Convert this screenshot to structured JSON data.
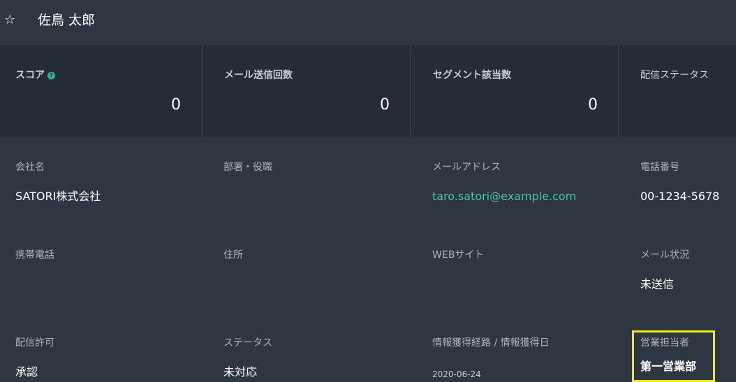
{
  "header": {
    "star_icon": "star-outline-icon",
    "name": "佐鳥 太郎"
  },
  "stats": [
    {
      "label": "スコア",
      "value": "0",
      "has_help": true
    },
    {
      "label": "メール送信回数",
      "value": "0"
    },
    {
      "label": "セグメント該当数",
      "value": "0"
    },
    {
      "label": "配信ステータス",
      "value": ""
    }
  ],
  "fields": {
    "company": {
      "label": "会社名",
      "value": "SATORI株式会社"
    },
    "department": {
      "label": "部署・役職",
      "value": ""
    },
    "email": {
      "label": "メールアドレス",
      "value": "taro.satori@example.com"
    },
    "phone": {
      "label": "電話番号",
      "value": "00-1234-5678"
    },
    "mobile": {
      "label": "携帯電話",
      "value": ""
    },
    "address": {
      "label": "住所",
      "value": ""
    },
    "website": {
      "label": "WEBサイト",
      "value": ""
    },
    "mail_status": {
      "label": "メール状況",
      "value": "未送信"
    },
    "delivery_permission": {
      "label": "配信許可",
      "value": "承認"
    },
    "status": {
      "label": "ステータス",
      "value": "未対応"
    },
    "acquisition": {
      "label": "情報獲得経路 / 情報獲得日",
      "value": "2020-06-24"
    },
    "sales_rep": {
      "label": "営業担当者",
      "value": "第一営業部"
    }
  },
  "colors": {
    "background": "#2e3642",
    "stats_background": "#252c37",
    "link": "#4fc3a1",
    "highlight": "#f2ea1a"
  }
}
